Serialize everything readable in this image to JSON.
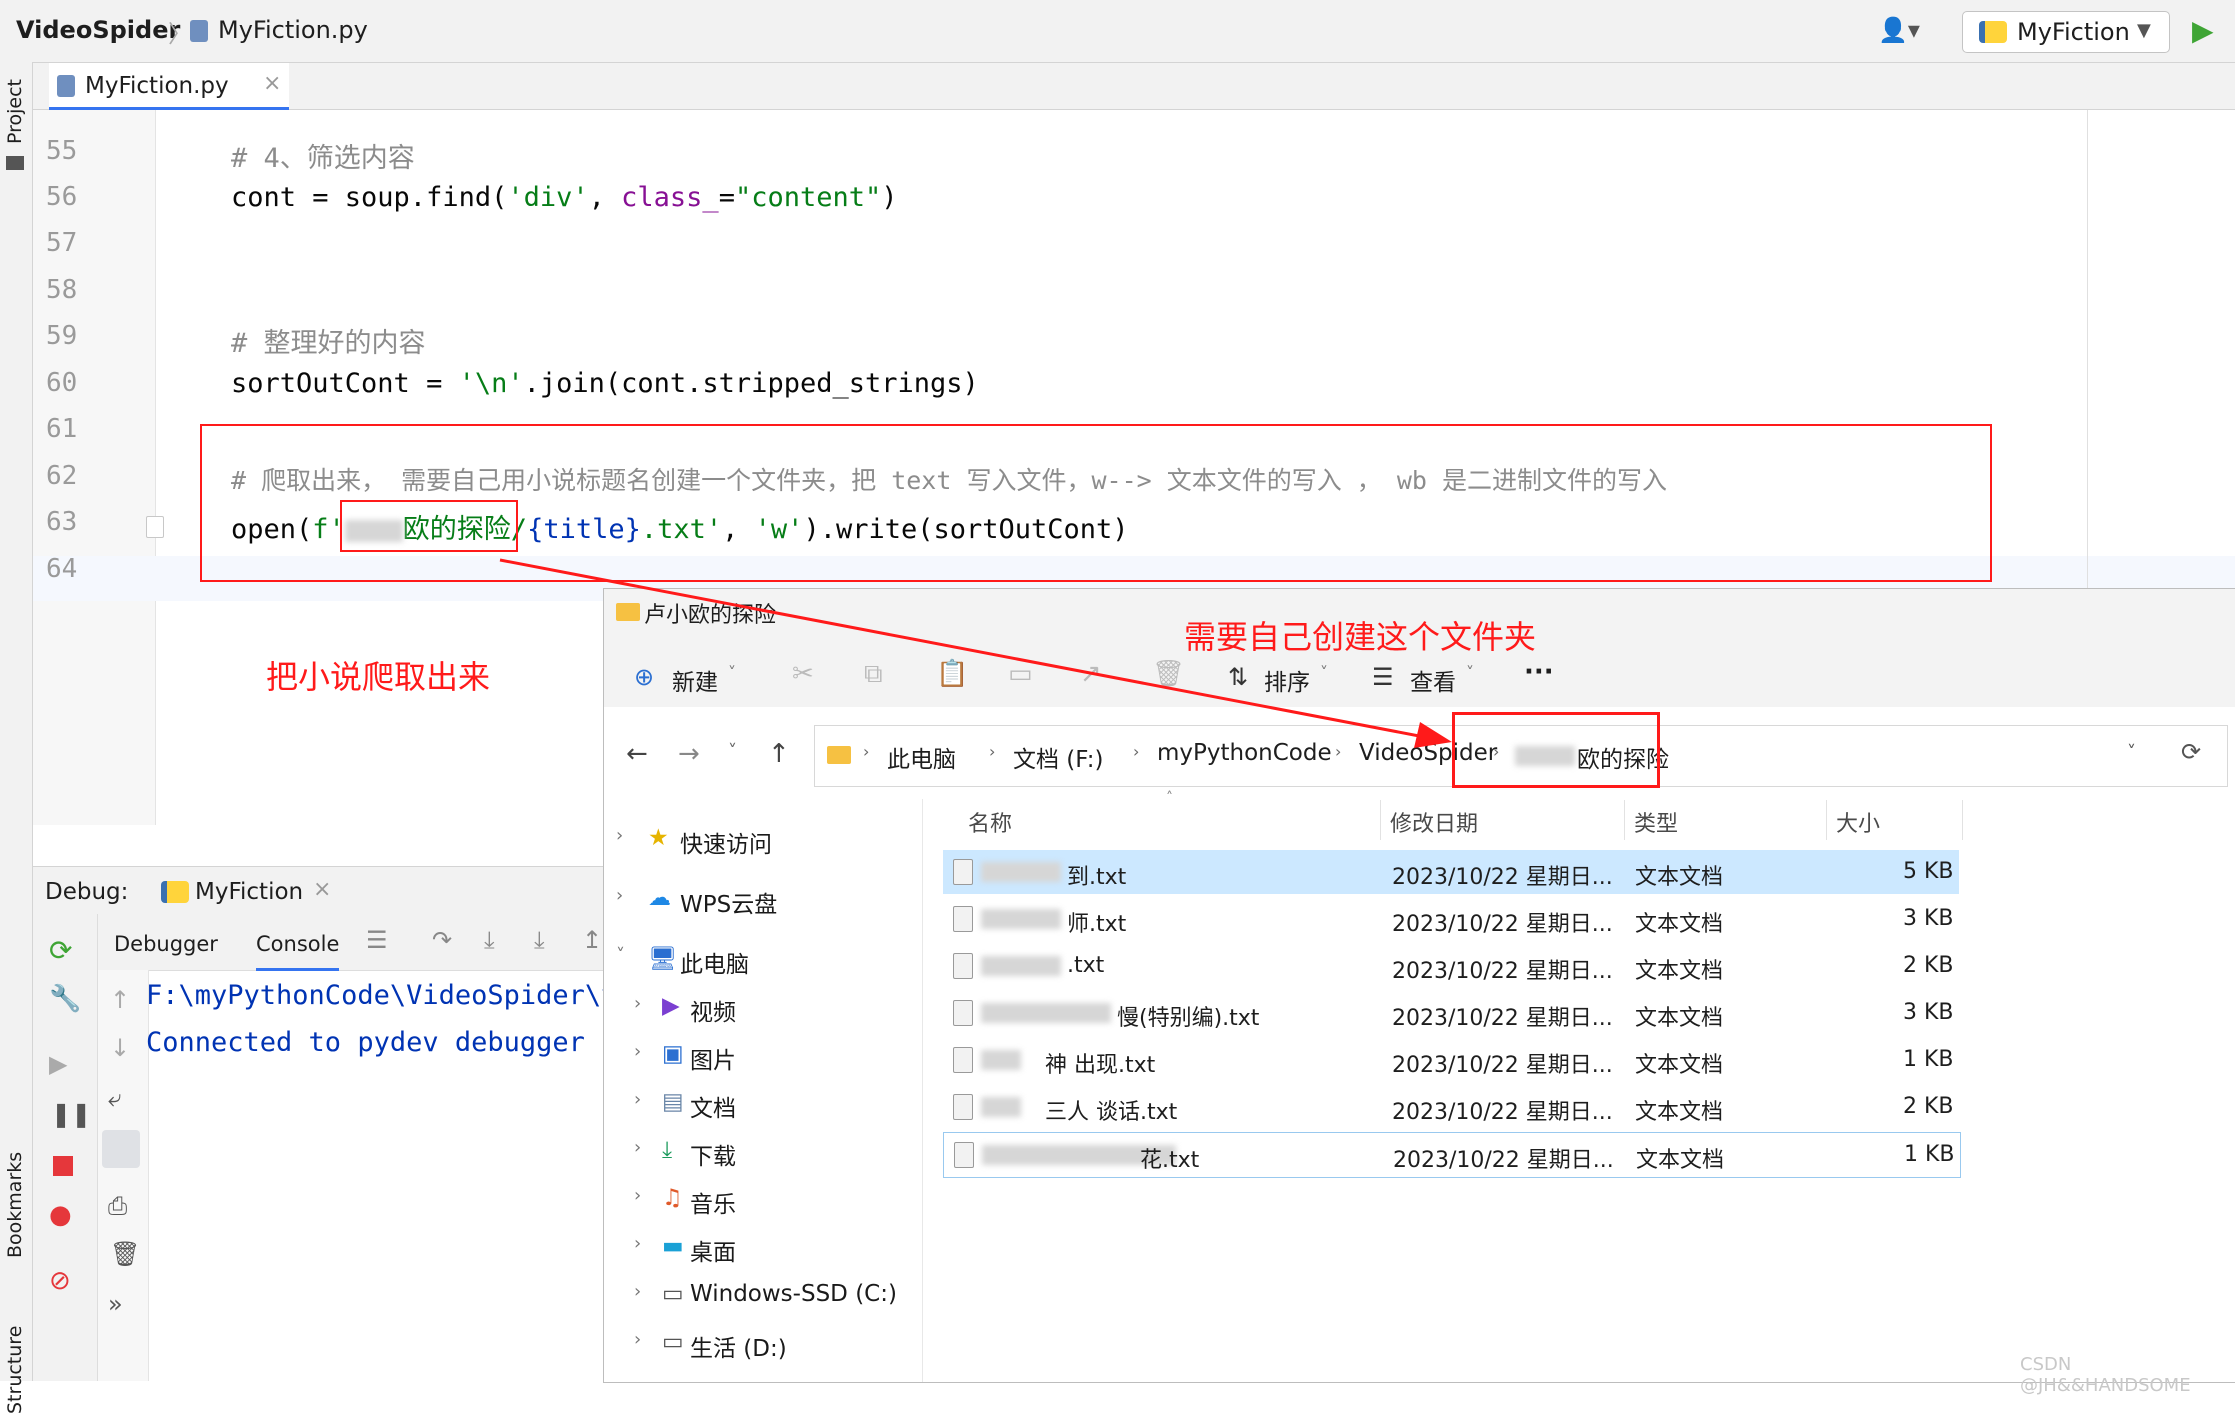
{
  "ide": {
    "project": "VideoSpider",
    "file_breadcrumb": "MyFiction.py",
    "run_config": "MyFiction",
    "editor_tab": "MyFiction.py",
    "left_tool_labels": [
      "Project",
      "Bookmarks",
      "Structure"
    ],
    "line_numbers": [
      "55",
      "56",
      "57",
      "58",
      "59",
      "60",
      "61",
      "62",
      "63",
      "64"
    ],
    "code": {
      "l55": "# 4、筛选内容",
      "l56_a": "cont = soup.find(",
      "l56_b": "'div'",
      "l56_c": ", ",
      "l56_d": "class_",
      "l56_e": "=",
      "l56_f": "\"content\"",
      "l56_g": ")",
      "l59": "# 整理好的内容",
      "l60_a": "sortOutCont = ",
      "l60_b": "'\\n'",
      "l60_c": ".join(cont.stripped_strings)",
      "l62": "# 爬取出来， 需要自己用小说标题名创建一个文件夹，把 text 写入文件，w--> 文本文件的写入 ， wb 是二进制文件的写入",
      "l63_a": "open(",
      "l63_b": "f'",
      "l63_c": "欧的探险/",
      "l63_d": "{title}",
      "l63_e": ".txt'",
      "l63_f": ", ",
      "l63_g": "'w'",
      "l63_h": ").write(sortOutCont)"
    },
    "debug": {
      "label": "Debug:",
      "config": "MyFiction",
      "tabs": [
        "Debugger",
        "Console"
      ],
      "console_lines": [
        "F:\\myPythonCode\\VideoSpider\\v",
        "Connected to pydev debugger ("
      ]
    }
  },
  "annotations": {
    "crawl_note": "把小说爬取出来",
    "folder_note": "需要自己创建这个文件夹"
  },
  "explorer": {
    "title": "卢小欧的探险",
    "toolbar": {
      "new": "新建",
      "sort": "排序",
      "view": "查看",
      "more": "···"
    },
    "breadcrumb": [
      "此电脑",
      "文档 (F:)",
      "myPythonCode",
      "VideoSpider",
      "欧的探险"
    ],
    "sidebar": [
      "快速访问",
      "WPS云盘",
      "此电脑",
      "视频",
      "图片",
      "文档",
      "下载",
      "音乐",
      "桌面",
      "Windows-SSD (C:)",
      "生活 (D:)"
    ],
    "columns": [
      "名称",
      "修改日期",
      "类型",
      "大小"
    ],
    "files": [
      {
        "name": "到.txt",
        "date": "2023/10/22  星期日...",
        "type": "文本文档",
        "size": "5 KB"
      },
      {
        "name": "师.txt",
        "date": "2023/10/22  星期日...",
        "type": "文本文档",
        "size": "3 KB"
      },
      {
        "name": ".txt",
        "date": "2023/10/22  星期日...",
        "type": "文本文档",
        "size": "2 KB"
      },
      {
        "name": "慢(特别编).txt",
        "date": "2023/10/22  星期日...",
        "type": "文本文档",
        "size": "3 KB"
      },
      {
        "name": "神 出现.txt",
        "date": "2023/10/22  星期日...",
        "type": "文本文档",
        "size": "1 KB"
      },
      {
        "name": "三人 谈话.txt",
        "date": "2023/10/22  星期日...",
        "type": "文本文档",
        "size": "2 KB"
      },
      {
        "name": "花.txt",
        "date": "2023/10/22  星期日...",
        "type": "文本文档",
        "size": "1 KB"
      }
    ]
  },
  "watermark": "CSDN @JH&&HANDSOME",
  "colors": {
    "annotation": "#ff1a1a",
    "selection": "#cce8ff",
    "run_green": "#3fa535"
  }
}
